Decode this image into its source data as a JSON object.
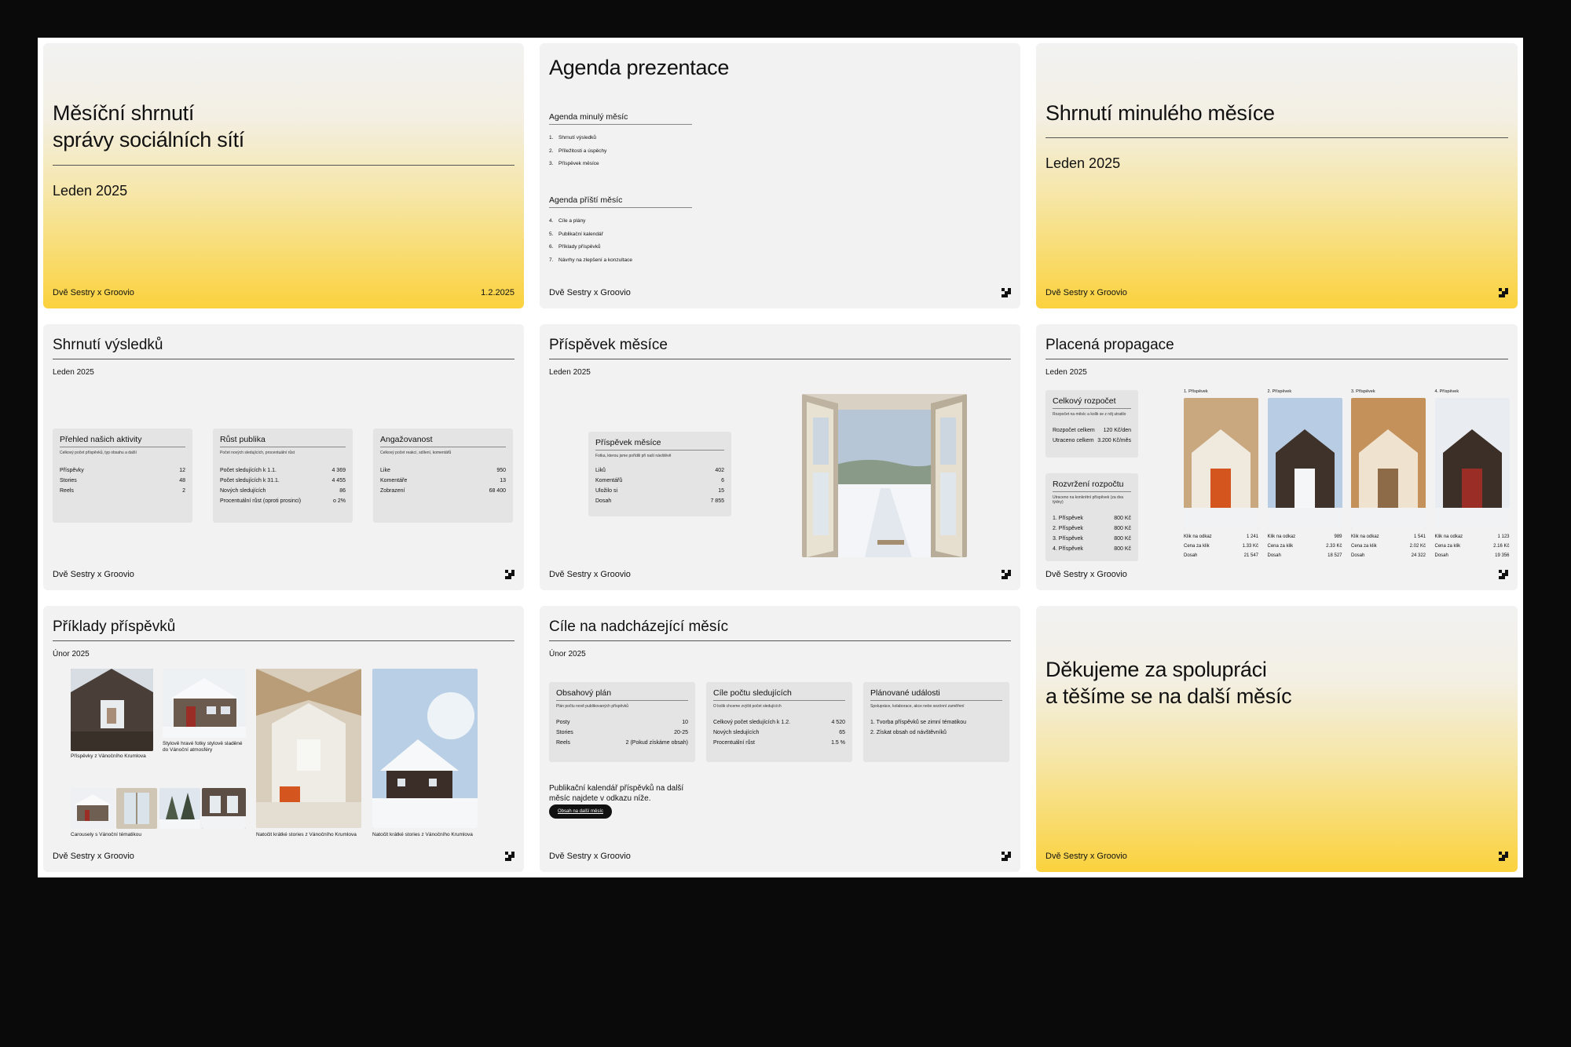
{
  "footer_brand": "Dvě Sestry x Groovio",
  "s1": {
    "title_l1": "Měsíční shrnutí",
    "title_l2": "správy sociálních sítí",
    "subtitle": "Leden 2025",
    "date": "1.2.2025"
  },
  "s2": {
    "title": "Agenda prezentace",
    "h1": "Agenda minulý měsíc",
    "items1": [
      [
        "1.",
        "Shrnutí výsledků"
      ],
      [
        "2.",
        "Příležitosti a úspěchy"
      ],
      [
        "3.",
        "Příspěvek měsíce"
      ]
    ],
    "h2": "Agenda příští měsíc",
    "items2": [
      [
        "4.",
        "Cíle a plány"
      ],
      [
        "5.",
        "Publikační kalendář"
      ],
      [
        "6.",
        "Příklady příspěvků"
      ],
      [
        "7.",
        "Návrhy na zlepšení a konzultace"
      ]
    ]
  },
  "s3": {
    "title": "Shrnutí minulého měsíce",
    "subtitle": "Leden 2025"
  },
  "s4": {
    "title": "Shrnutí výsledků",
    "subtitle": "Leden 2025",
    "cards": [
      {
        "title": "Přehled našich aktivity",
        "desc": "Celkový počet příspěvků, typ obsahu a další",
        "rows": [
          [
            "Příspěvky",
            "12"
          ],
          [
            "Stories",
            "48"
          ],
          [
            "Reels",
            "2"
          ]
        ]
      },
      {
        "title": "Růst publika",
        "desc": "Počet nových sledujících, procentuální růst",
        "rows": [
          [
            "Počet sledujících k 1.1.",
            "4 369"
          ],
          [
            "Počet sledujících k 31.1.",
            "4 455"
          ],
          [
            "Nových sledujících",
            "86"
          ],
          [
            "Procentuální růst (oproti prosinci)",
            "o 2%"
          ]
        ]
      },
      {
        "title": "Angažovanost",
        "desc": "Celkový počet reakcí, sdílení, komentářů",
        "rows": [
          [
            "Like",
            "950"
          ],
          [
            "Komentáře",
            "13"
          ],
          [
            "Zobrazení",
            "68 400"
          ]
        ]
      }
    ]
  },
  "s5": {
    "title": "Příspěvek měsíce",
    "subtitle": "Leden 2025",
    "card": {
      "title": "Příspěvek měsíce",
      "desc": "Fotka, kterou jsme pořídili při naší návštěvě",
      "rows": [
        [
          "Liků",
          "402"
        ],
        [
          "Komentářů",
          "6"
        ],
        [
          "Uložilo si",
          "15"
        ],
        [
          "Dosah",
          "7 855"
        ]
      ]
    }
  },
  "s6": {
    "title": "Placená propagace",
    "subtitle": "Leden 2025",
    "budget": {
      "title": "Celkový rozpočet",
      "desc": "Rozpočet na měsíc a kolik se z něj utratilo",
      "rows": [
        [
          "Rozpočet celkem",
          "120 Kč/den"
        ],
        [
          "Utraceno celkem",
          "3.200 Kč/měs"
        ]
      ]
    },
    "split": {
      "title": "Rozvržení rozpočtu",
      "desc": "Utraceno na konkrétní příspěvek (za dva týdny)",
      "rows": [
        [
          "1. Příspěvek",
          "800 Kč"
        ],
        [
          "2. Příspěvek",
          "800 Kč"
        ],
        [
          "3. Příspěvek",
          "800 Kč"
        ],
        [
          "4. Příspěvek",
          "800 Kč"
        ]
      ]
    },
    "posts": [
      {
        "label": "1. Příspěvek",
        "rows": [
          [
            "Klik na odkaz",
            "1 241"
          ],
          [
            "Cena za klik",
            "1.33 Kč"
          ],
          [
            "Dosah",
            "21 547"
          ]
        ]
      },
      {
        "label": "2. Příspěvek",
        "rows": [
          [
            "Klik na odkaz",
            "989"
          ],
          [
            "Cena za klik",
            "2.33 Kč"
          ],
          [
            "Dosah",
            "18 527"
          ]
        ]
      },
      {
        "label": "3. Příspěvek",
        "rows": [
          [
            "Klik na odkaz",
            "1 541"
          ],
          [
            "Cena za klik",
            "2.02 Kč"
          ],
          [
            "Dosah",
            "24 322"
          ]
        ]
      },
      {
        "label": "4. Příspěvek",
        "rows": [
          [
            "Klik na odkaz",
            "1 123"
          ],
          [
            "Cena za klik",
            "2.16 Kč"
          ],
          [
            "Dosah",
            "19 356"
          ]
        ]
      }
    ]
  },
  "s7": {
    "title": "Příklady příspěvků",
    "subtitle": "Únor 2025",
    "cap1": "Příspěvky z Vánočního Krumlova",
    "cap2": "Stylově hravé fotky stylově sladěné do Vánoční atmosféry",
    "cap3": "Carousely s Vánoční tématikou",
    "cap4": "Natočit krátké stories z Vánočního Krumlova",
    "cap5": "Natočit krátké stories z Vánočního Krumlova"
  },
  "s8": {
    "title": "Cíle na nadcházející měsíc",
    "subtitle": "Únor 2025",
    "cards": [
      {
        "title": "Obsahový plán",
        "desc": "Plán počtu nově publikovaných příspěvků",
        "rows": [
          [
            "Posty",
            "10"
          ],
          [
            "Stories",
            "20-25"
          ],
          [
            "Reels",
            "2 (Pokud získáme obsah)"
          ]
        ]
      },
      {
        "title": "Cíle počtu sledujících",
        "desc": "O kolik chceme zvýšit počet sledujících",
        "rows": [
          [
            "Celkový počet sledujících k 1.2.",
            "4 520"
          ],
          [
            "Nových sledujících",
            "65"
          ],
          [
            "Procentuální růst",
            "1.5 %"
          ]
        ]
      },
      {
        "title": "Plánované události",
        "desc": "Spolupráce, kolaborace, akce nebo sezónní zaměření",
        "rows": [
          [
            "1.   Tvorba příspěvků se zimní tématikou",
            ""
          ],
          [
            "2.   Získat obsah od návštěvníků",
            ""
          ]
        ]
      }
    ],
    "note": "Publikační kalendář příspěvků na další měsíc najdete v odkazu níže.",
    "button": "Obsah na další měsíc"
  },
  "s9": {
    "title_l1": "Děkujeme za spolupráci",
    "title_l2": "a těšíme se na další měsíc"
  }
}
